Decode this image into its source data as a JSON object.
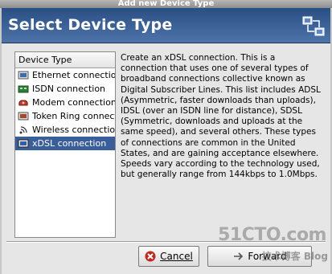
{
  "window": {
    "title": "Add new Device Type"
  },
  "banner": {
    "title": "Select Device Type"
  },
  "list": {
    "header": "Device Type",
    "items": [
      {
        "label": "Ethernet connection",
        "icon": "ethernet-icon"
      },
      {
        "label": "ISDN connection",
        "icon": "isdn-icon"
      },
      {
        "label": "Modem connection",
        "icon": "modem-icon"
      },
      {
        "label": "Token Ring connecti",
        "icon": "token-ring-icon"
      },
      {
        "label": "Wireless connection",
        "icon": "wireless-icon"
      },
      {
        "label": "xDSL connection",
        "icon": "xdsl-icon",
        "selected": true
      }
    ]
  },
  "description": "Create an xDSL connection.  This is a connection that uses one of several types of broadband connections collective known as Digital Subscriber Lines.  This list includes ADSL (Asymmetric, faster downloads than uploads), IDSL (over an ISDN line for distance), SDSL (Symmetric, downloads and uploads at the same speed), and several others.  These types of connections are common in the United States, and are gaining acceptance elsewhere.  Speeds vary according to the technology used, but generally range from 144kbps to 1.0Mbps.",
  "buttons": {
    "cancel": "Cancel",
    "forward": "Forward"
  },
  "watermark": {
    "line1": "51CTO.com",
    "line2": "技术博客 Blog"
  },
  "colors": {
    "banner": "#3a5e9a",
    "selection": "#3a5e9a"
  }
}
